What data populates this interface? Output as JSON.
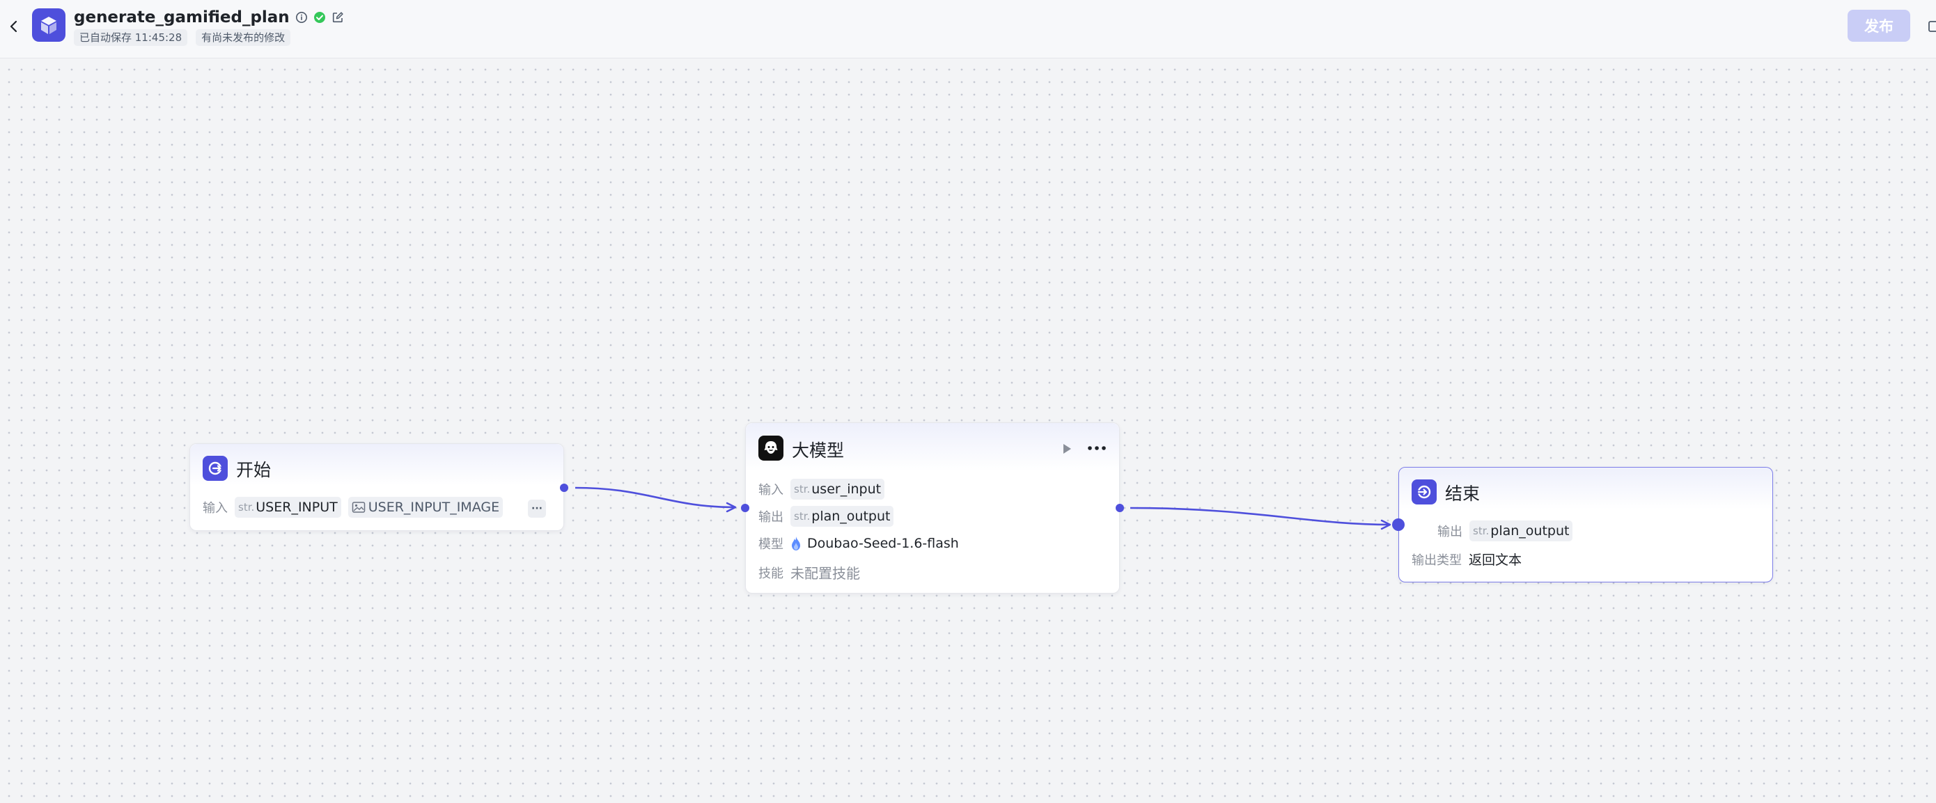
{
  "header": {
    "title": "generate_gamified_plan",
    "autosave_label": "已自动保存 11:45:28",
    "unpublished_label": "有尚未发布的修改",
    "publish_label": "发布",
    "accent_color": "#4e4fdc"
  },
  "nodes": {
    "start": {
      "title": "开始",
      "input_label": "输入",
      "params": [
        {
          "type": "str.",
          "name": "USER_INPUT"
        },
        {
          "type": "image",
          "name": "USER_INPUT_IMAGE"
        }
      ],
      "more_label": "···"
    },
    "llm": {
      "title": "大模型",
      "input_label": "输入",
      "input_param": {
        "type": "str.",
        "name": "user_input"
      },
      "output_label": "输出",
      "output_param": {
        "type": "str.",
        "name": "plan_output"
      },
      "model_label": "模型",
      "model_name": "Doubao-Seed-1.6-flash",
      "skill_label": "技能",
      "skill_value": "未配置技能"
    },
    "end": {
      "title": "结束",
      "output_label": "输出",
      "output_param": {
        "type": "str.",
        "name": "plan_output"
      },
      "output_type_label": "输出类型",
      "output_type_value": "返回文本"
    }
  },
  "icons": {
    "back": "chevron-left-icon",
    "app": "cube-icon",
    "info": "info-icon",
    "status": "check-circle-icon",
    "edit": "edit-icon",
    "start": "start-node-icon",
    "llm": "llm-node-icon",
    "end": "end-node-icon",
    "run": "play-icon",
    "more": "more-icon",
    "model": "flame-icon",
    "image": "image-icon"
  }
}
